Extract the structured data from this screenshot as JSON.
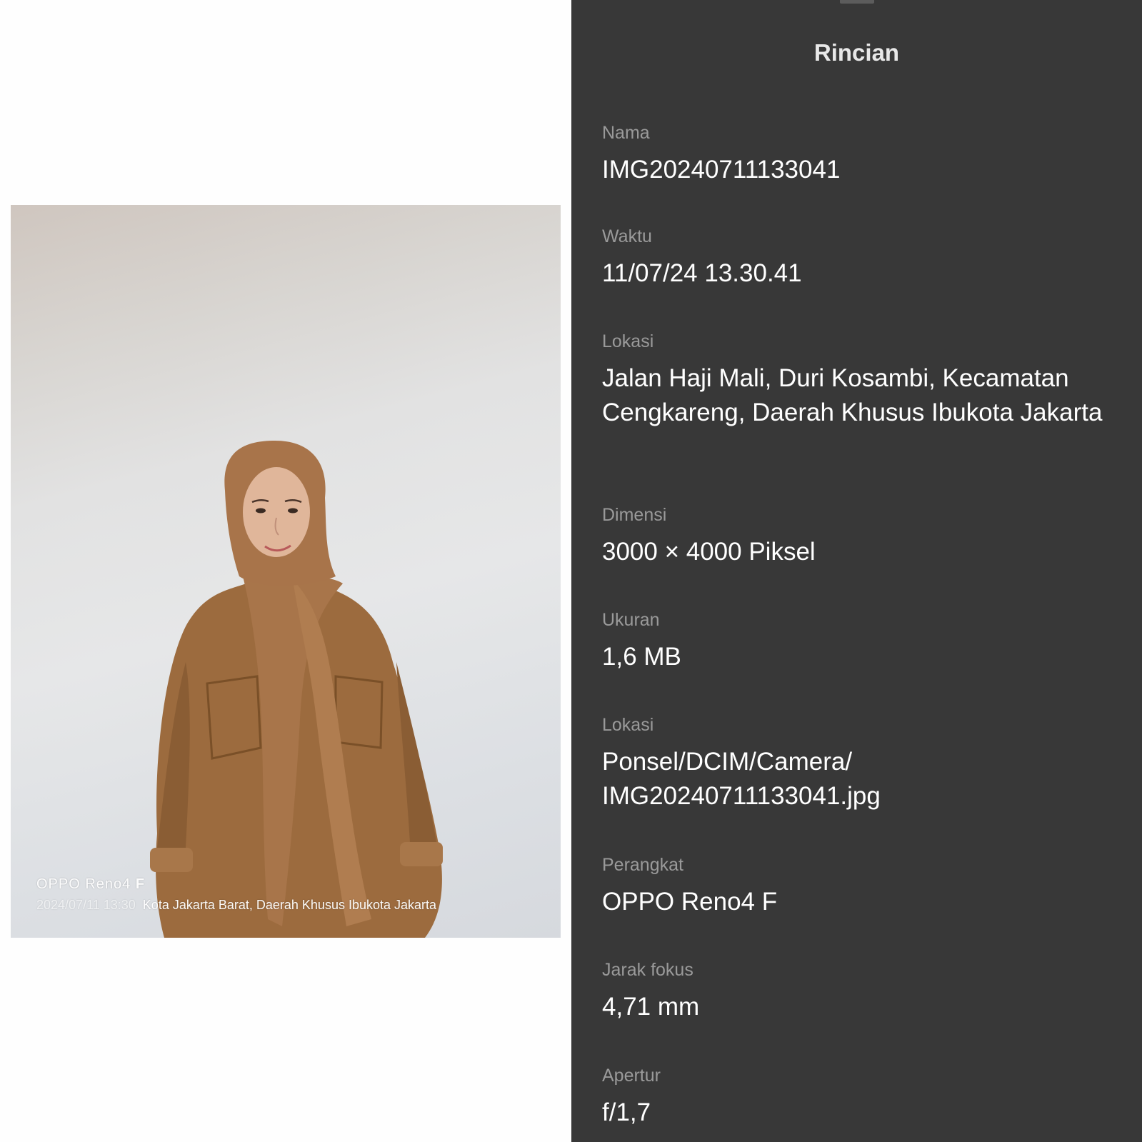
{
  "photo": {
    "watermark": {
      "brand": "OPPO Reno4",
      "model_suffix": "F",
      "datetime": "2024/07/11 13:30",
      "place": "Kota Jakarta Barat, Daerah Khusus Ibukota Jakarta"
    }
  },
  "details": {
    "title": "Rincian",
    "fields": [
      {
        "label": "Nama",
        "value": "IMG20240711133041"
      },
      {
        "label": "Waktu",
        "value": "11/07/24 13.30.41"
      },
      {
        "label": "Lokasi",
        "value": "Jalan Haji Mali, Duri Kosambi, Kecamatan Cengkareng, Daerah Khusus Ibukota Jakarta"
      },
      {
        "label": "Dimensi",
        "value": "3000 × 4000 Piksel"
      },
      {
        "label": "Ukuran",
        "value": "1,6 MB"
      },
      {
        "label": "Lokasi",
        "value": "Ponsel/DCIM/Camera/ IMG20240711133041.jpg"
      },
      {
        "label": "Perangkat",
        "value": "OPPO Reno4 F"
      },
      {
        "label": "Jarak fokus",
        "value": "4,71 mm"
      },
      {
        "label": "Apertur",
        "value": "f/1,7"
      }
    ]
  }
}
